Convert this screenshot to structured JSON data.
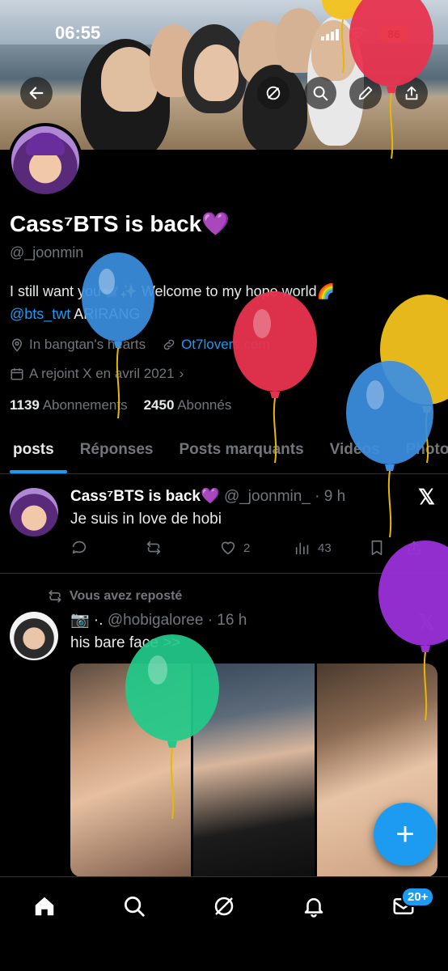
{
  "status": {
    "time": "06:55",
    "battery": "86"
  },
  "profile": {
    "name": "Cass⁷BTS is back",
    "handle": "@_joonmin",
    "bio_line1": "I still want you🦋✨ Welcome to my hope world🌈",
    "bio_mention": "@bts_twt",
    "bio_line2_rest": " ARIRANG",
    "location": "In bangtan's hearts",
    "website": "Ot7lovers.com",
    "joined": "A rejoint X en avril 2021",
    "following_count": "1139",
    "following_label": "Abonnements",
    "followers_count": "2450",
    "followers_label": "Abonnés"
  },
  "tabs": [
    "posts",
    "Réponses",
    "Posts marquants",
    "Vidéos",
    "Photos"
  ],
  "post1": {
    "name": "Cass⁷BTS is back",
    "handle_time": "@_joonmin_ · 9 h",
    "text": "Je suis in love de hobi",
    "likes": "2",
    "views": "43"
  },
  "repost": {
    "label": "Vous avez reposté",
    "name": "📷 ·.",
    "handle_time": "@hobigaloree · 16 h",
    "text": "his bare face >>"
  },
  "colors": {
    "accent": "#1d9bf0",
    "heart": "#a855f7"
  },
  "icons": [
    "back-arrow-icon",
    "grok-icon",
    "search-icon",
    "edit-icon",
    "share-icon",
    "home-icon",
    "explore-icon",
    "notifications-icon",
    "messages-icon"
  ],
  "nav": {
    "messages_badge": "20+"
  },
  "fab_label": "+"
}
